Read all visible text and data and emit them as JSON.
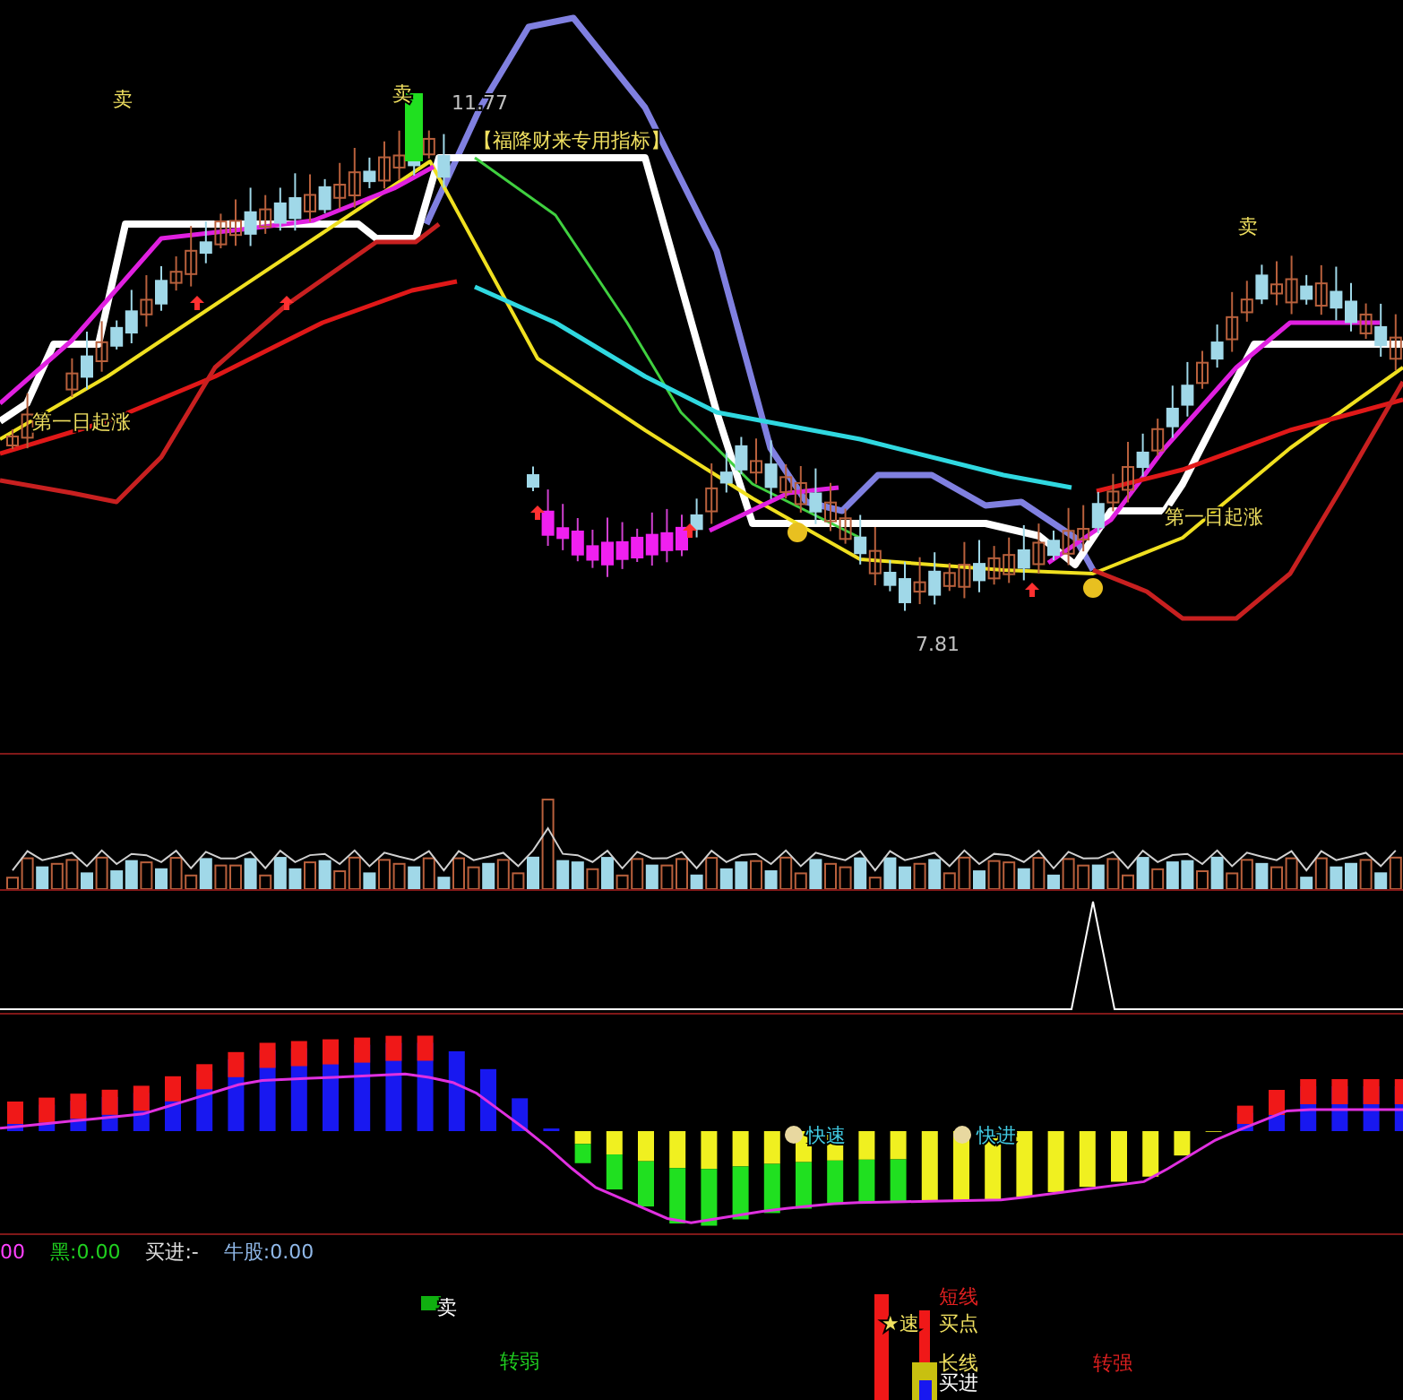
{
  "main_chart": {
    "sell_signals": [
      "卖",
      "卖",
      "卖"
    ],
    "high_price": "11.77",
    "indicator_title": "【福降财来专用指标】",
    "rise_labels": [
      "第一日起涨",
      "第一日起涨"
    ],
    "low_price": "7.81"
  },
  "macd_panel": {
    "labels": [
      "快速",
      "快进"
    ]
  },
  "status_line": [
    {
      "text": "00",
      "color": "#ff40ff"
    },
    {
      "text": "黑:0.00",
      "color": "#20d020"
    },
    {
      "text": "买进:-",
      "color": "#e0e0e0"
    },
    {
      "text": "牛股:0.00",
      "color": "#90b8e8"
    }
  ],
  "signal_panel": {
    "sell_tag": "卖",
    "weak_label": "转弱",
    "short_line": "短线",
    "fast_buy": "★速",
    "buy_point": "买点",
    "long_line": "长线",
    "buy_in": "买进",
    "strong_label": "转强"
  }
}
